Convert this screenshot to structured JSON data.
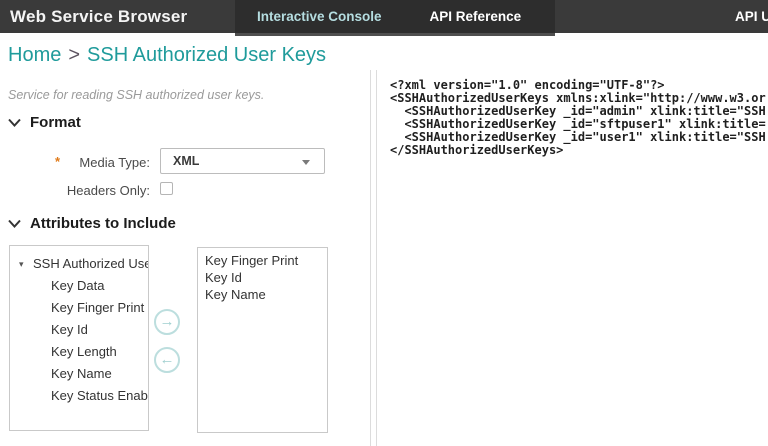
{
  "header": {
    "app_title": "Web Service Browser",
    "tabs": [
      {
        "label": "Interactive Console",
        "active": true
      },
      {
        "label": "API Reference",
        "active": false
      }
    ],
    "right_link": "API Use"
  },
  "breadcrumb": {
    "home": "Home",
    "separator": ">",
    "current": "SSH Authorized User Keys"
  },
  "service": {
    "description": "Service for reading SSH authorized user keys.",
    "format_section": {
      "title": "Format",
      "media_type_required_marker": "*",
      "media_type_label": "Media Type:",
      "media_type_value": "XML",
      "headers_only_label": "Headers Only:",
      "headers_only_checked": false
    },
    "attributes_section": {
      "title": "Attributes to Include",
      "tree_root_label": "SSH Authorized Use",
      "tree_children": [
        "Key Data",
        "Key Finger Print",
        "Key Id",
        "Key Length",
        "Key Name",
        "Key Status Enab"
      ],
      "selected_attributes": [
        "Key Finger Print",
        "Key Id",
        "Key Name"
      ]
    }
  },
  "xml_output": {
    "lines": [
      "<?xml version=\"1.0\" encoding=\"UTF-8\"?>",
      "<SSHAuthorizedUserKeys xmlns:xlink=\"http://www.w3.or",
      "  <SSHAuthorizedUserKey _id=\"admin\" xlink:title=\"SSH",
      "  <SSHAuthorizedUserKey _id=\"sftpuser1\" xlink:title=",
      "  <SSHAuthorizedUserKey _id=\"user1\" xlink:title=\"SSH",
      "</SSHAuthorizedUserKeys>"
    ]
  },
  "colors": {
    "teal_link": "#1f9b9b",
    "header_bg": "#3a3a3a",
    "tabstrip_bg": "#2d2d2d",
    "active_tab_text": "#b5dde0",
    "required_marker": "#e07b1a",
    "arrow_button": "#9fcfcf"
  }
}
